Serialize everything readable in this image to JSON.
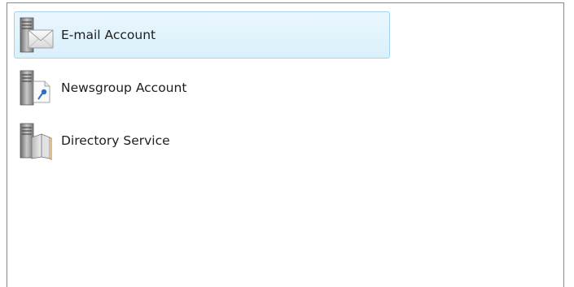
{
  "account_types": {
    "items": [
      {
        "label": "E-mail Account",
        "icon": "email-server-icon",
        "selected": true
      },
      {
        "label": "Newsgroup Account",
        "icon": "newsgroup-server-icon",
        "selected": false
      },
      {
        "label": "Directory Service",
        "icon": "directory-server-icon",
        "selected": false
      }
    ]
  },
  "colors": {
    "selection_fill": "#d9f0fc",
    "selection_border": "#a6d3ef",
    "list_border": "#828790"
  }
}
